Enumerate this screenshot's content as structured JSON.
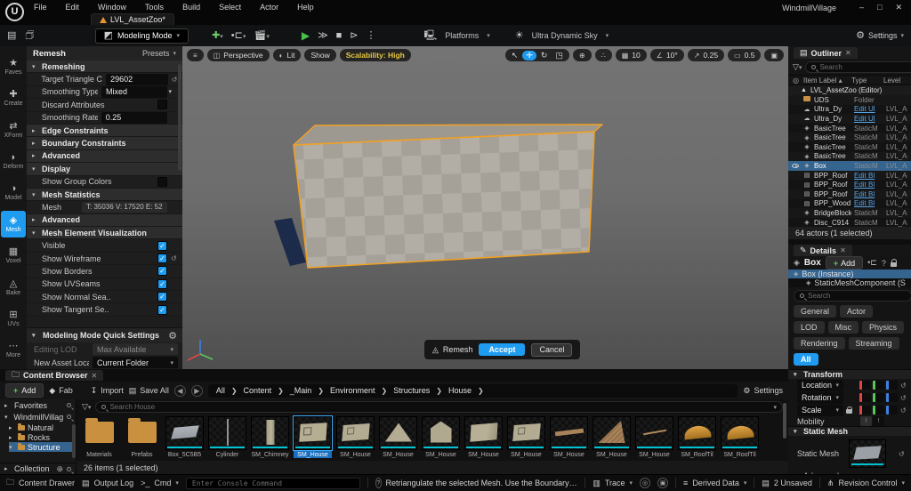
{
  "colors": {
    "accent": "#1f9cf0",
    "selrow": "#35648f",
    "link": "#58a6e8",
    "folder": "#c9913f",
    "cyan": "#00c2d1",
    "mesh-outline": "#f0a125",
    "scalability": "#e8c93e",
    "axis-x": "#e24444",
    "axis-y": "#57c757",
    "axis-z": "#3f7fe0"
  },
  "titlebar": {
    "menus": [
      "File",
      "Edit",
      "Window",
      "Tools",
      "Build",
      "Select",
      "Actor",
      "Help"
    ],
    "tab_label": "LVL_AssetZoo*",
    "window_title": "WindmillVillage",
    "minimize": "–",
    "maximize": "□",
    "close": "✕"
  },
  "toolbar": {
    "mode_label": "Modeling Mode",
    "platforms_label": "Platforms",
    "sky_label": "Ultra Dynamic Sky",
    "settings_label": "Settings"
  },
  "mode_rail": {
    "items": [
      {
        "label": "Faves",
        "icon": "star",
        "glyph": "★",
        "selected": false
      },
      {
        "label": "Create",
        "icon": "create",
        "glyph": "✚",
        "selected": false
      },
      {
        "label": "XForm",
        "icon": "xform",
        "glyph": "⇄",
        "selected": false
      },
      {
        "label": "Deform",
        "icon": "deform",
        "glyph": "◗",
        "selected": false
      },
      {
        "label": "Model",
        "icon": "model",
        "glyph": "◑",
        "selected": false
      },
      {
        "label": "Mesh",
        "icon": "mesh",
        "glyph": "◈",
        "selected": true
      },
      {
        "label": "Voxel",
        "icon": "voxel",
        "glyph": "▦",
        "selected": false
      },
      {
        "label": "Bake",
        "icon": "bake",
        "glyph": "◬",
        "selected": false
      },
      {
        "label": "UVs",
        "icon": "uvs",
        "glyph": "⊞",
        "selected": false
      },
      {
        "label": "More",
        "icon": "more",
        "glyph": "⋯",
        "selected": false
      }
    ]
  },
  "remesh_panel": {
    "title": "Remesh",
    "presets_label": "Presets",
    "rows": [
      {
        "kind": "header",
        "label": "Remeshing",
        "expanded": true
      },
      {
        "kind": "field-input",
        "label": "Target Triangle C...",
        "value": "29602",
        "reset": true
      },
      {
        "kind": "field-select",
        "label": "Smoothing Type",
        "value": "Mixed"
      },
      {
        "kind": "field-check",
        "label": "Discard Attributes",
        "checked": false
      },
      {
        "kind": "field-input",
        "label": "Smoothing Rate",
        "value": "0.25"
      },
      {
        "kind": "header",
        "label": "Edge Constraints",
        "expanded": false
      },
      {
        "kind": "header",
        "label": "Boundary Constraints",
        "expanded": false
      },
      {
        "kind": "header",
        "label": "Advanced",
        "expanded": false
      },
      {
        "kind": "header",
        "label": "Display",
        "expanded": true
      },
      {
        "kind": "field-check",
        "label": "Show Group Colors",
        "checked": false
      },
      {
        "kind": "header",
        "label": "Mesh Statistics",
        "expanded": true
      },
      {
        "kind": "field-text",
        "label": "Mesh",
        "value": "T: 35036  V: 17520  E: 52"
      },
      {
        "kind": "header",
        "label": "Advanced",
        "expanded": false
      },
      {
        "kind": "header",
        "label": "Mesh Element Visualization",
        "expanded": true
      },
      {
        "kind": "field-check",
        "label": "Visible",
        "checked": true
      },
      {
        "kind": "field-check",
        "label": "Show Wireframe",
        "checked": true,
        "reset": true
      },
      {
        "kind": "field-check",
        "label": "Show Borders",
        "checked": true
      },
      {
        "kind": "field-check",
        "label": "Show UVSeams",
        "checked": true
      },
      {
        "kind": "field-check",
        "label": "Show Normal Sea..",
        "checked": true
      },
      {
        "kind": "field-check",
        "label": "Show Tangent Se..",
        "checked": true
      }
    ],
    "quick": {
      "title": "Modeling Mode Quick Settings",
      "lod_label": "Editing LOD",
      "lod_value": "Max Available",
      "asset_label": "New Asset Locati",
      "asset_value": "Current Folder"
    }
  },
  "viewport": {
    "perspective": "Perspective",
    "lit": "Lit",
    "show": "Show",
    "scalability": "Scalability: High",
    "snaps": {
      "grid": "10",
      "angle": "10°",
      "scale": "0.25",
      "camera": "0.5"
    },
    "remesh_overlay": {
      "label": "Remesh",
      "accept": "Accept",
      "cancel": "Cancel"
    }
  },
  "outliner": {
    "tab": "Outliner",
    "search_placeholder": "Search",
    "columns": {
      "label": "Item Label",
      "type": "Type",
      "level": "Level"
    },
    "world_row": "LVL_AssetZoo (Editor)",
    "rows": [
      {
        "label": "UDS",
        "type": "Folder",
        "level": "",
        "icon": "folder",
        "type_link": false
      },
      {
        "label": "Ultra_Dy",
        "type": "Edit Ul",
        "level": "LVL_As",
        "icon": "sky",
        "type_link": true
      },
      {
        "label": "Ultra_Dy",
        "type": "Edit Ul",
        "level": "LVL_As",
        "icon": "sky",
        "type_link": true
      },
      {
        "label": "BasicTree",
        "type": "StaticM",
        "level": "LVL_As",
        "icon": "staticmesh",
        "type_link": false
      },
      {
        "label": "BasicTree",
        "type": "StaticM",
        "level": "LVL_As",
        "icon": "staticmesh",
        "type_link": false
      },
      {
        "label": "BasicTree",
        "type": "StaticM",
        "level": "LVL_As",
        "icon": "staticmesh",
        "type_link": false
      },
      {
        "label": "BasicTree",
        "type": "StaticM",
        "level": "LVL_As",
        "icon": "staticmesh",
        "type_link": false
      },
      {
        "label": "Box",
        "type": "StaticM",
        "level": "LVL_As",
        "icon": "staticmesh",
        "type_link": false,
        "selected": true,
        "eye": true
      },
      {
        "label": "BPP_Roof",
        "type": "Edit Bl",
        "level": "LVL_As",
        "icon": "blueprint",
        "type_link": true
      },
      {
        "label": "BPP_Roof",
        "type": "Edit Bl",
        "level": "LVL_As",
        "icon": "blueprint",
        "type_link": true
      },
      {
        "label": "BPP_Roof",
        "type": "Edit Bl",
        "level": "LVL_As",
        "icon": "blueprint",
        "type_link": true
      },
      {
        "label": "BPP_Wood",
        "type": "Edit Bl",
        "level": "LVL_As",
        "icon": "blueprint",
        "type_link": true
      },
      {
        "label": "BridgeBlock",
        "type": "StaticM",
        "level": "LVL_As",
        "icon": "staticmesh",
        "type_link": false
      },
      {
        "label": "Disc_C914",
        "type": "StaticM",
        "level": "LVL_As",
        "icon": "staticmesh",
        "type_link": false
      }
    ],
    "footer": "64 actors (1 selected)"
  },
  "details": {
    "tab": "Details",
    "object_name": "Box",
    "add_label": "Add",
    "instance_row": "Box (Instance)",
    "component_row": "StaticMeshComponent (StaticM",
    "search_placeholder": "Search",
    "chips": [
      {
        "label": "General"
      },
      {
        "label": "Actor"
      },
      {
        "label": "LOD"
      },
      {
        "label": "Misc"
      },
      {
        "label": "Physics"
      },
      {
        "label": "Rendering"
      },
      {
        "label": "Streaming"
      },
      {
        "label": "All",
        "active": true
      }
    ],
    "transform_title": "Transform",
    "transform_rows": [
      {
        "label": "Location",
        "lock": false,
        "reset": true
      },
      {
        "label": "Rotation",
        "lock": false,
        "reset": true
      },
      {
        "label": "Scale",
        "lock": true,
        "reset": true
      }
    ],
    "mobility_label": "Mobility",
    "static_mesh_title": "Static Mesh",
    "static_mesh_label": "Static Mesh",
    "advanced_label": "Advanced"
  },
  "content_browser": {
    "tab": "Content Browser",
    "add_label": "Add",
    "fab_label": "Fab",
    "import_label": "Import",
    "save_all_label": "Save All",
    "breadcrumb": [
      "All",
      "Content",
      "_Main",
      "Environment",
      "Structures",
      "House"
    ],
    "settings_label": "Settings",
    "favorites_label": "Favorites",
    "project_label": "WindmillVillage",
    "tree": [
      {
        "label": "Natural",
        "selected": false
      },
      {
        "label": "Rocks",
        "selected": false
      },
      {
        "label": "Structure",
        "selected": true
      }
    ],
    "collection_label": "Collection",
    "search_placeholder": "Search House",
    "items": [
      {
        "name": "Materials",
        "thumb": "folder",
        "selected": false
      },
      {
        "name": "Prefabs",
        "thumb": "folder",
        "selected": false
      },
      {
        "name": "Box_5C5B5",
        "thumb": "box",
        "selected": false
      },
      {
        "name": "Cylinder",
        "thumb": "cylinder",
        "selected": false
      },
      {
        "name": "SM_Chimney",
        "thumb": "chimney",
        "selected": false
      },
      {
        "name": "SM_House",
        "thumb": "wall-window",
        "selected": true
      },
      {
        "name": "SM_House",
        "thumb": "wall",
        "selected": false
      },
      {
        "name": "SM_House",
        "thumb": "triangle",
        "selected": false
      },
      {
        "name": "SM_House",
        "thumb": "gable",
        "selected": false
      },
      {
        "name": "SM_House",
        "thumb": "wall2",
        "selected": false
      },
      {
        "name": "SM_House",
        "thumb": "wall",
        "selected": false
      },
      {
        "name": "SM_House",
        "thumb": "plank",
        "selected": false
      },
      {
        "name": "SM_House",
        "thumb": "roof-triangle",
        "selected": false
      },
      {
        "name": "SM_House",
        "thumb": "plank-thin",
        "selected": false
      },
      {
        "name": "SM_RoofTil",
        "thumb": "roof-tile",
        "selected": false
      },
      {
        "name": "SM_RoofTil",
        "thumb": "roof-tile",
        "selected": false
      }
    ],
    "footer": "26 items (1 selected)"
  },
  "status_bar": {
    "content_drawer": "Content Drawer",
    "output_log": "Output Log",
    "cmd": "Cmd",
    "console_placeholder": "Enter Console Command",
    "message": "Retriangulate the selected Mesh. Use the Boundary Constraints to preserve mesh borders. Enable Discard Attributes",
    "trace": "Trace",
    "derived_data": "Derived Data",
    "unsaved": "2 Unsaved",
    "revision": "Revision Control"
  }
}
